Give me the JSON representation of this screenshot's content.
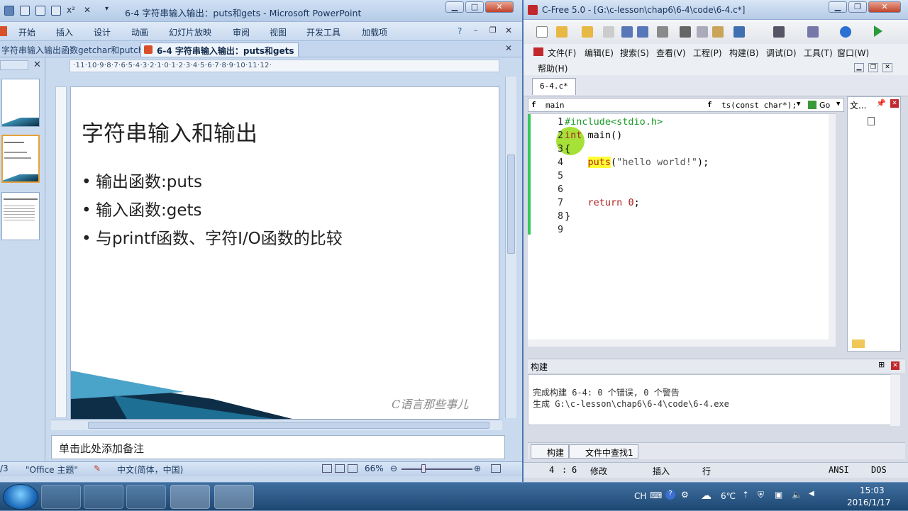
{
  "ppt": {
    "window_title": "6-4 字符串输入输出：puts和gets - Microsoft PowerPoint",
    "ribbon_tabs": [
      "开始",
      "插入",
      "设计",
      "动画",
      "幻灯片放映",
      "审阅",
      "视图",
      "开发工具",
      "加载项"
    ],
    "doc_tabs": [
      "字符串输入输出函数getchar和putchar",
      "6-4 字符串输入输出：puts和gets"
    ],
    "ruler_text": "·11·10·9·8·7·6·5·4·3·2·1·0·1·2·3·4·5·6·7·8·9·10·11·12·",
    "slide": {
      "title": "字符串输入和输出",
      "bullets": [
        "输出函数:puts",
        "输入函数:gets",
        "与printf函数、字符I/O函数的比较"
      ],
      "watermark": "C语言那些事儿"
    },
    "notes_placeholder": "单击此处添加备注",
    "status": {
      "slide_num": "/3",
      "theme": "\"Office 主题\"",
      "language": "中文(简体，中国)",
      "zoom": "66%"
    }
  },
  "cfree": {
    "window_title": "C-Free 5.0 - [G:\\c-lesson\\chap6\\6-4\\code\\6-4.c*]",
    "menu": [
      "文件(F)",
      "编辑(E)",
      "搜索(S)",
      "查看(V)",
      "工程(P)",
      "构建(B)",
      "调试(D)",
      "工具(T)",
      "窗口(W)"
    ],
    "menu_help": "帮助(H)",
    "file_tab": "6-4.c*",
    "combo_scope": "main",
    "combo_func": "ts(const char*);",
    "go_label": "Go",
    "side_tab": "文...",
    "code_lines": [
      {
        "n": "1",
        "t": "#include<stdio.h>"
      },
      {
        "n": "2",
        "t": "int main()"
      },
      {
        "n": "3",
        "t": "{"
      },
      {
        "n": "4",
        "t": "    puts(\"hello world!\");"
      },
      {
        "n": "5",
        "t": ""
      },
      {
        "n": "6",
        "t": ""
      },
      {
        "n": "7",
        "t": "    return 0;"
      },
      {
        "n": "8",
        "t": "}"
      },
      {
        "n": "9",
        "t": ""
      }
    ],
    "build_title": "构建",
    "build_output": [
      "完成构建 6-4: 0 个错误, 0 个警告",
      "生成 G:\\c-lesson\\chap6\\6-4\\code\\6-4.exe"
    ],
    "build_tabs": [
      "构建",
      "文件中查找1"
    ],
    "status": {
      "line": "4",
      "col": "6",
      "modified": "修改",
      "insert": "插入",
      "row_label": "行",
      "encoding": "ANSI",
      "eol": "DOS"
    }
  },
  "taskbar": {
    "tray": {
      "ime": "CH",
      "temp": "6℃",
      "time": "15:03",
      "date": "2016/1/17"
    }
  },
  "colors": {
    "accent": "#4c78b4",
    "gutter_green": "#36c95a",
    "highlight": "#ffff33"
  }
}
